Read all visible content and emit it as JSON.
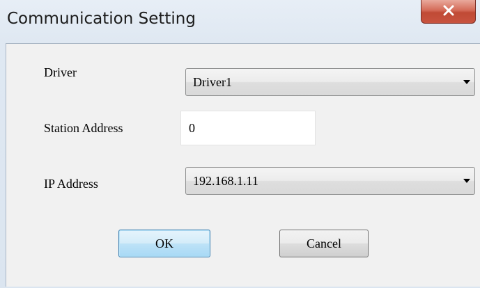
{
  "window": {
    "title": "Communication Setting",
    "close_icon": "close-icon"
  },
  "form": {
    "driver": {
      "label": "Driver",
      "value": "Driver1"
    },
    "station_address": {
      "label": "Station Address",
      "value": "0"
    },
    "ip_address": {
      "label": "IP Address",
      "value": "192.168.1.11"
    }
  },
  "buttons": {
    "ok_label": "OK",
    "cancel_label": "Cancel"
  },
  "colors": {
    "close_button": "#c8533f",
    "ok_border": "#3c7fb1",
    "client_background": "#f1f1f1"
  }
}
